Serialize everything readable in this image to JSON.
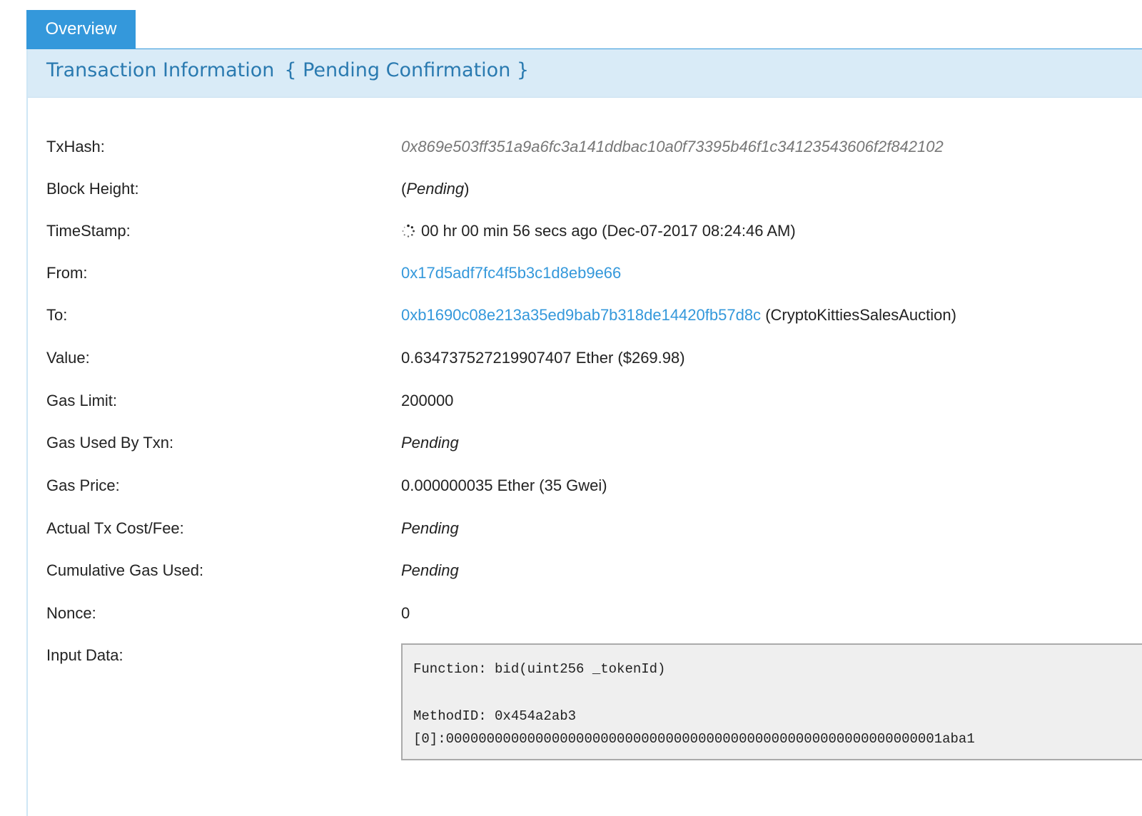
{
  "tabs": [
    {
      "label": "Overview",
      "active": true
    }
  ],
  "panel": {
    "title": "Transaction Information",
    "status": "{ Pending Confirmation }"
  },
  "fields": {
    "txhash": {
      "label": "TxHash:",
      "value": "0x869e503ff351a9a6fc3a141ddbac10a0f73395b46f1c34123543606f2f842102"
    },
    "block_height": {
      "label": "Block Height:",
      "value": "Pending"
    },
    "timestamp": {
      "label": "TimeStamp:",
      "relative": "00 hr 00 min 56 secs ago",
      "absolute": "(Dec-07-2017 08:24:46 AM)"
    },
    "from": {
      "label": "From:",
      "address": "0x17d5adf7fc4f5b3c1d8eb9e66"
    },
    "to": {
      "label": "To:",
      "address": "0xb1690c08e213a35ed9bab7b318de14420fb57d8c",
      "name": "(CryptoKittiesSalesAuction)"
    },
    "value": {
      "label": "Value:",
      "value": "0.634737527219907407 Ether ($269.98)"
    },
    "gas_limit": {
      "label": "Gas Limit:",
      "value": "200000"
    },
    "gas_used": {
      "label": "Gas Used By Txn:",
      "value": "Pending"
    },
    "gas_price": {
      "label": "Gas Price:",
      "value": "0.000000035 Ether (35 Gwei)"
    },
    "actual_cost": {
      "label": "Actual Tx Cost/Fee:",
      "value": "Pending"
    },
    "cumulative_gas": {
      "label": "Cumulative Gas Used:",
      "value": "Pending"
    },
    "nonce": {
      "label": "Nonce:",
      "value": "0"
    },
    "input_data": {
      "label": "Input Data:",
      "function": "Function: bid(uint256 _tokenId)",
      "method_id": "MethodID: 0x454a2ab3",
      "param0": "[0]:0000000000000000000000000000000000000000000000000000000000001aba1"
    }
  },
  "colors": {
    "accent": "#3498db",
    "header_bg": "#d9ebf7",
    "title": "#2a7ab0",
    "link": "#3498db"
  },
  "icons": {
    "timestamp": "spinner-icon"
  }
}
